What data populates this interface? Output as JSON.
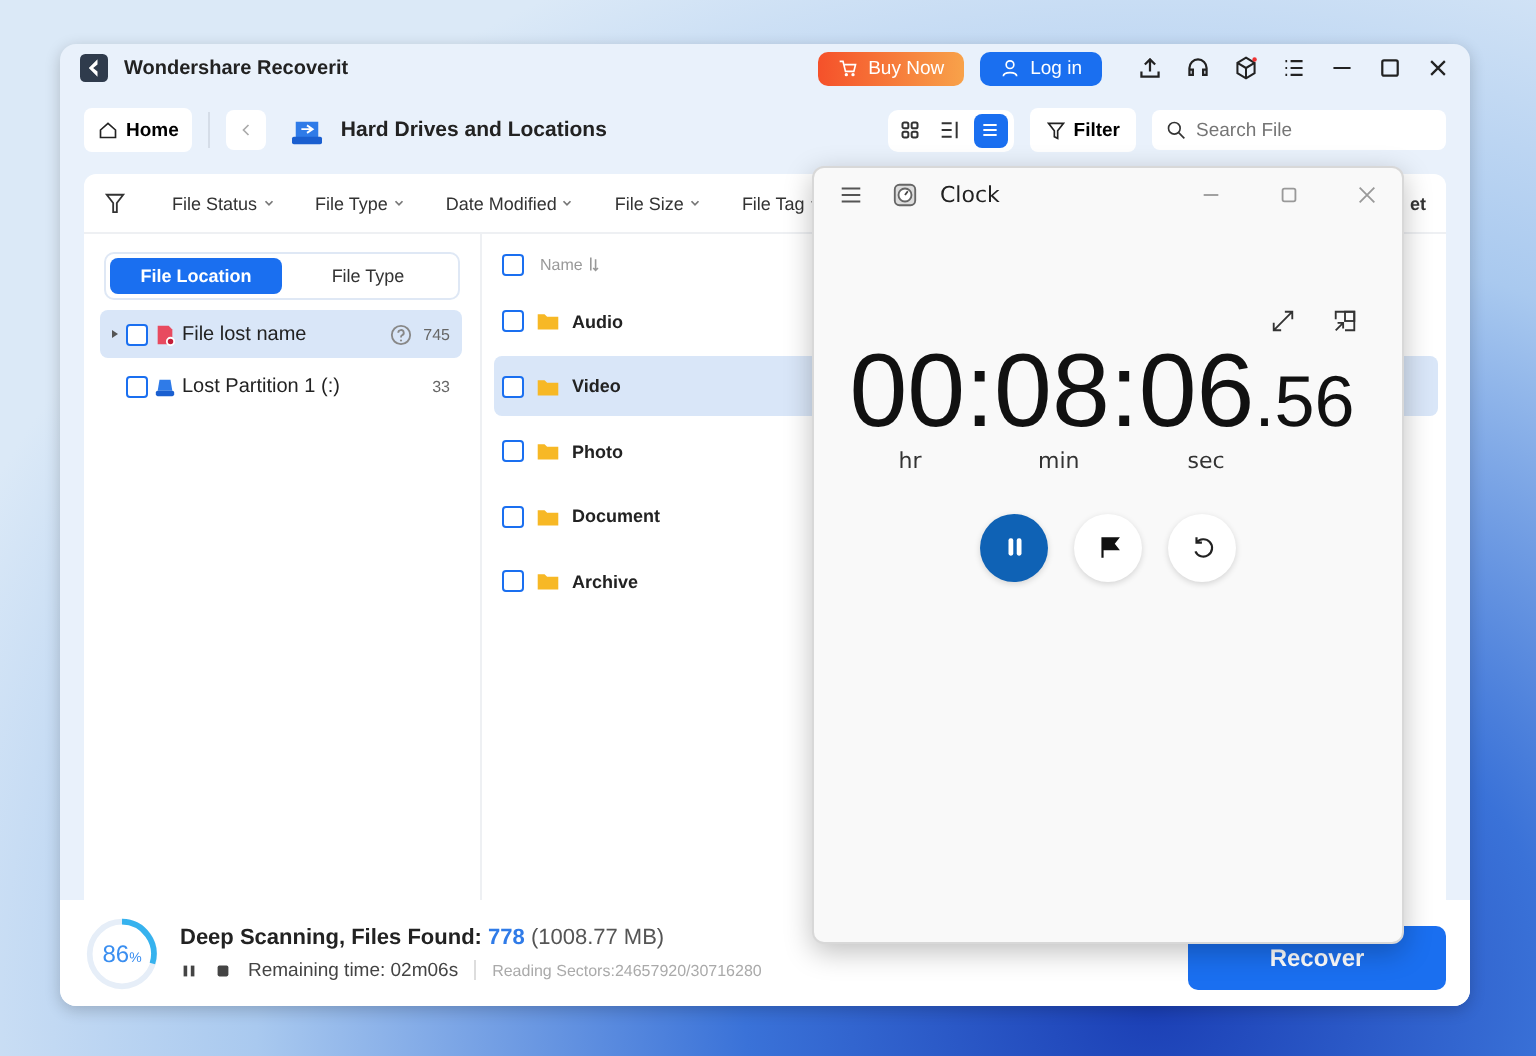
{
  "app_window": {
    "title": "Wondershare Recoverit",
    "buy_button": "Buy Now",
    "login_button": "Log in"
  },
  "toolbar": {
    "home_button": "Home",
    "location": "Hard Drives and Locations",
    "views": [
      {
        "kind": "grid",
        "selected": false
      },
      {
        "kind": "details",
        "selected": false
      },
      {
        "kind": "list",
        "selected": true
      }
    ],
    "filter_button": "Filter",
    "search": {
      "placeholder": "Search File"
    }
  },
  "filter_bar": {
    "items": [
      "File Status",
      "File Type",
      "Date Modified",
      "File Size",
      "File Tag"
    ],
    "partial_text": "et"
  },
  "left_tabs": [
    {
      "label": "File Location",
      "selected": true
    },
    {
      "label": "File Type",
      "selected": false
    }
  ],
  "tree": [
    {
      "name": "File lost name",
      "kind": "lost",
      "count": "745",
      "selected": true,
      "checked": false,
      "expandable": true
    },
    {
      "name": "Lost Partition 1 (:)",
      "kind": "partition",
      "count": "33",
      "selected": false,
      "checked": false,
      "expandable": false
    }
  ],
  "file_list": {
    "header": "Name",
    "header_checked": false,
    "rows": [
      {
        "name": "Audio",
        "selected": false,
        "checked": false
      },
      {
        "name": "Video",
        "selected": true,
        "checked": false
      },
      {
        "name": "Photo",
        "selected": false,
        "checked": false
      },
      {
        "name": "Document",
        "selected": false,
        "checked": false
      },
      {
        "name": "Archive",
        "selected": false,
        "checked": false
      }
    ]
  },
  "status": {
    "percent": "86",
    "percent_sign": "%",
    "title": "Deep Scanning, Files Found:",
    "count": "778",
    "size": "(1008.77 MB)",
    "remaining_label": "Remaining time:",
    "remaining": "02m06s",
    "sectors": "Reading Sectors:24657920/30716280",
    "recover_button": "Recover"
  },
  "clock_window": {
    "title": "Clock",
    "time_main": "00:08:06",
    "time_fraction": ".56",
    "units": [
      "hr",
      "min",
      "sec"
    ],
    "running": true
  }
}
